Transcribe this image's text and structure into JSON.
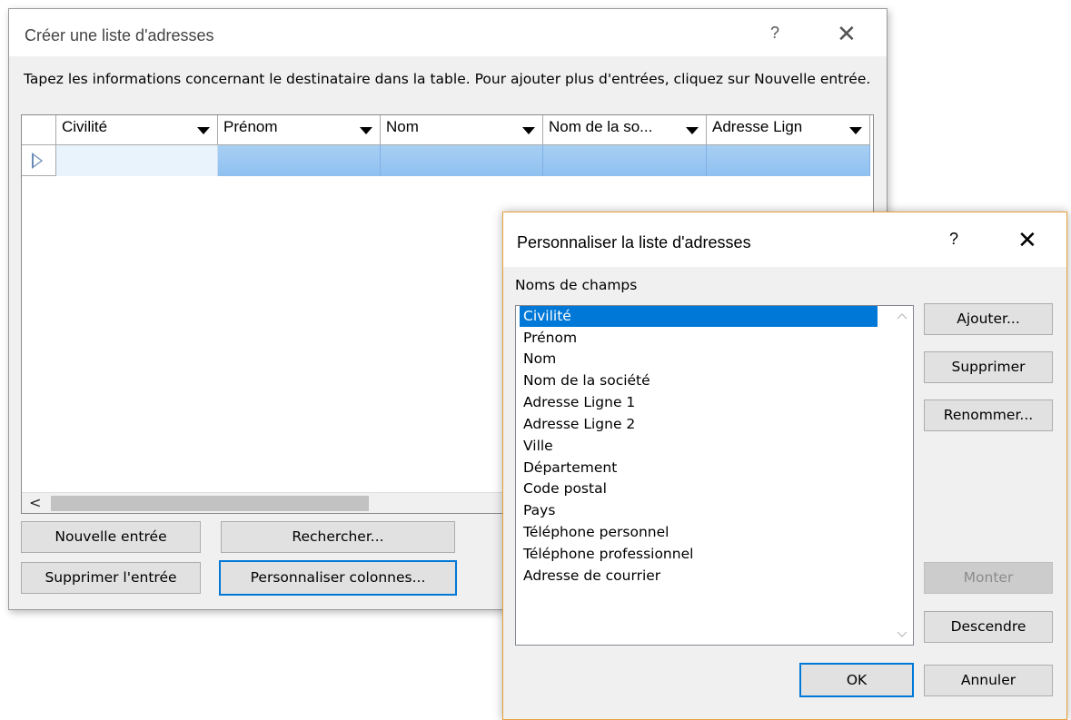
{
  "main_dialog": {
    "title": "Créer une liste d'adresses",
    "help": "?",
    "close": "✕",
    "instructions": "Tapez les informations concernant le destinataire dans la table. Pour ajouter plus d'entrées, cliquez sur Nouvelle entrée.",
    "columns": [
      "Civilité",
      "Prénom",
      "Nom",
      "Nom de la so...",
      "Adresse Lign"
    ],
    "scroll_left": "<",
    "buttons": {
      "new_entry": "Nouvelle entrée",
      "search": "Rechercher...",
      "delete_entry": "Supprimer l'entrée",
      "customize_columns": "Personnaliser colonnes..."
    }
  },
  "custom_dialog": {
    "title": "Personnaliser la liste d'adresses",
    "help": "?",
    "close": "✕",
    "fields_label": "Noms de champs",
    "fields": [
      "Civilité",
      "Prénom",
      "Nom",
      "Nom de la société",
      "Adresse Ligne 1",
      "Adresse Ligne 2",
      "Ville",
      "Département",
      "Code postal",
      "Pays",
      "Téléphone personnel",
      "Téléphone professionnel",
      "Adresse de courrier"
    ],
    "selected_field": "Civilité",
    "buttons": {
      "add": "Ajouter...",
      "delete": "Supprimer",
      "rename": "Renommer...",
      "move_up": "Monter",
      "move_down": "Descendre",
      "ok": "OK",
      "cancel": "Annuler"
    }
  },
  "colors": {
    "accent": "#0078d7",
    "dialog_border_active": "#e8a13a",
    "selected_row": "#8ec0f0"
  }
}
